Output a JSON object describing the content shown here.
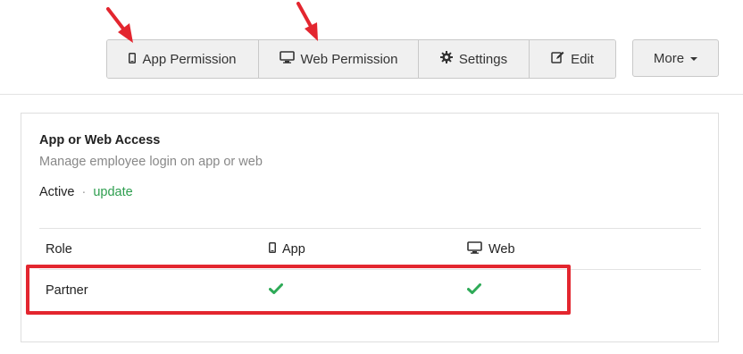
{
  "toolbar": {
    "buttons": [
      {
        "label": "App Permission",
        "icon": "mobile-icon"
      },
      {
        "label": "Web Permission",
        "icon": "desktop-icon"
      },
      {
        "label": "Settings",
        "icon": "gear-icon"
      },
      {
        "label": "Edit",
        "icon": "edit-icon"
      }
    ],
    "more_label": "More"
  },
  "panel": {
    "title": "App or Web Access",
    "subtitle": "Manage employee login on app or web",
    "status": "Active",
    "separator": "·",
    "update_link": "update",
    "table": {
      "headers": {
        "role": "Role",
        "app": "App",
        "web": "Web"
      },
      "rows": [
        {
          "role": "Partner",
          "app": true,
          "web": true
        }
      ]
    }
  },
  "annotations": {
    "color": "#e3262f",
    "accent_green": "#2eaa57"
  }
}
